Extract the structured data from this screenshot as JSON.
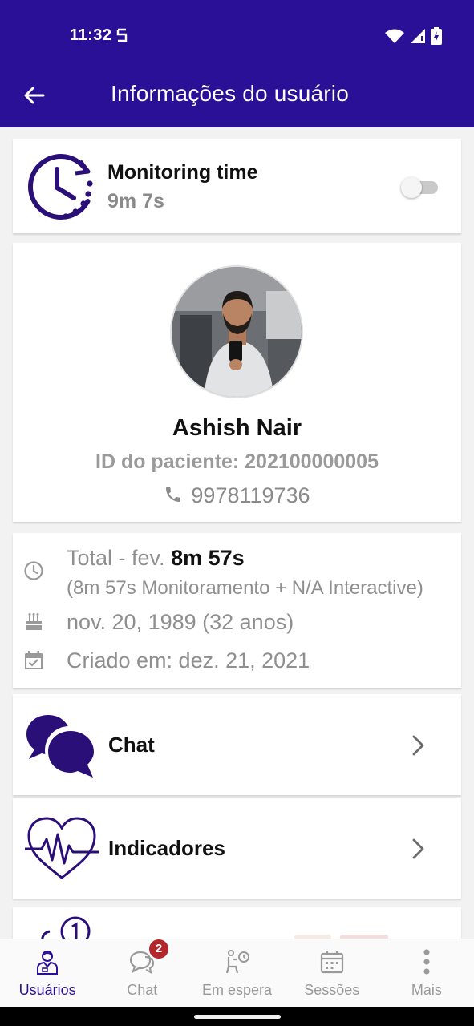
{
  "status_bar": {
    "time": "11:32"
  },
  "app_bar": {
    "title": "Informações do usuário"
  },
  "monitoring": {
    "label": "Monitoring time",
    "value": "9m 7s",
    "toggle_on": false
  },
  "profile": {
    "name": "Ashish Nair",
    "patient_id": "ID do paciente: 202100000005",
    "phone": "9978119736"
  },
  "info": {
    "total_prefix": "Total - fev.",
    "total_value": "8m 57s",
    "total_detail": "(8m 57s Monitoramento + N/A Interactive)",
    "birthdate": "nov. 20, 1989 (32 anos)",
    "created": "Criado em: dez. 21, 2021"
  },
  "nav_cards": [
    {
      "label": "Chat",
      "icon": "chat-bubbles-icon"
    },
    {
      "label": "Indicadores",
      "icon": "heart-pulse-icon"
    }
  ],
  "bottom_nav": {
    "items": [
      {
        "label": "Usuários",
        "icon": "user-icon",
        "active": true
      },
      {
        "label": "Chat",
        "icon": "chat-icon",
        "badge": "2"
      },
      {
        "label": "Em espera",
        "icon": "waiting-icon"
      },
      {
        "label": "Sessões",
        "icon": "calendar-icon"
      },
      {
        "label": "Mais",
        "icon": "more-vertical-icon"
      }
    ]
  },
  "colors": {
    "primary": "#2a1097",
    "icon_purple": "#2a0f78",
    "badge": "#b3262a",
    "muted_text": "#8f8f8f"
  }
}
